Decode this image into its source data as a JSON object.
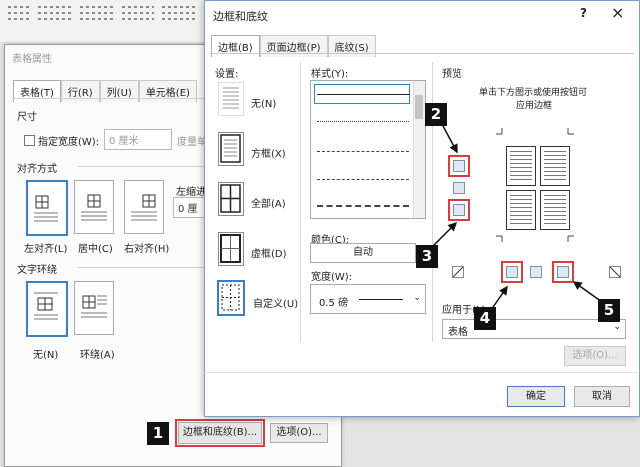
{
  "back_dialog": {
    "title": "表格属性",
    "tabs": [
      "表格(T)",
      "行(R)",
      "列(U)",
      "单元格(E)"
    ],
    "size_label": "尺寸",
    "preferred_width_label": "指定宽度(W):",
    "width_value": "0 厘米",
    "measure_label": "度量单",
    "alignment_label": "对齐方式",
    "indent_label": "左缩进",
    "indent_value": "0 厘",
    "align_options": [
      "左对齐(L)",
      "居中(C)",
      "右对齐(H)"
    ],
    "wrap_label": "文字环绕",
    "wrap_options": [
      "无(N)",
      "环绕(A)"
    ],
    "borders_button": "边框和底纹(B)...",
    "options_button": "选项(O)..."
  },
  "front_dialog": {
    "title": "边框和底纹",
    "help": "?",
    "close": "×",
    "tabs": [
      "边框(B)",
      "页面边框(P)",
      "底纹(S)"
    ],
    "setting_label": "设置:",
    "settings": [
      "无(N)",
      "方框(X)",
      "全部(A)",
      "虚框(D)",
      "自定义(U)"
    ],
    "style_label": "样式(Y):",
    "color_label": "颜色(C):",
    "color_value": "自动",
    "width_label": "宽度(W):",
    "width_value": "0.5 磅",
    "preview_label": "预览",
    "preview_hint_line1": "单击下方图示或使用按钮可",
    "preview_hint_line2": "应用边框",
    "apply_label": "应用于(L):",
    "apply_value": "表格",
    "options_button": "选项(O)...",
    "ok_button": "确定",
    "cancel_button": "取消"
  },
  "badges": [
    "1",
    "2",
    "3",
    "4",
    "5"
  ],
  "colors": {
    "highlight": "#d34040",
    "accent": "#3d7fc4",
    "badge": "#111111"
  }
}
